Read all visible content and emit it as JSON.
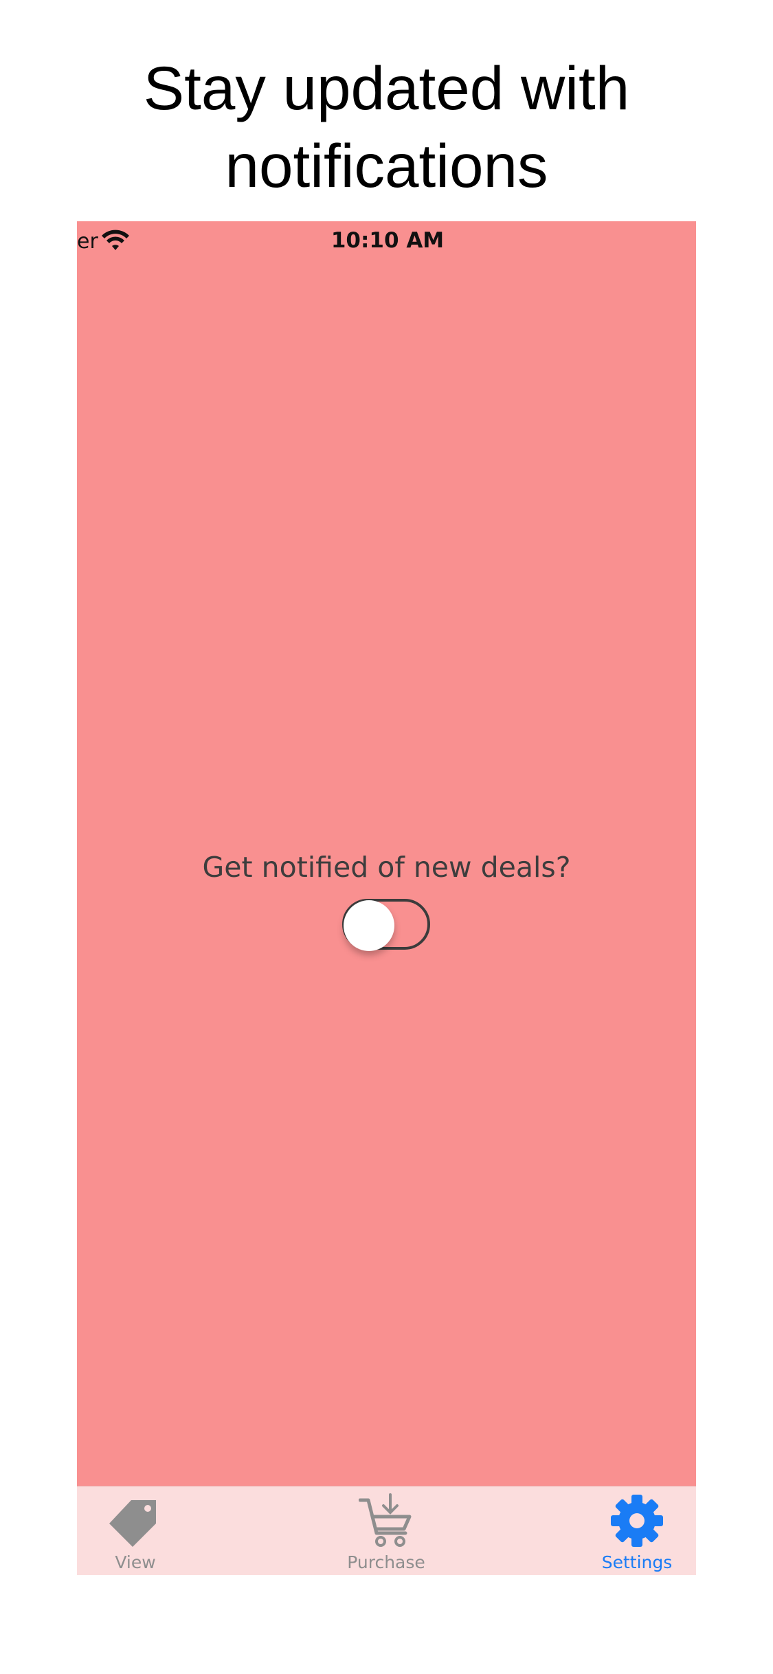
{
  "headline": {
    "line1": "Stay updated with",
    "line2": "notifications"
  },
  "status_bar": {
    "carrier": "er",
    "time": "10:10 AM",
    "wifi_icon": "wifi-icon"
  },
  "settings": {
    "prompt": "Get notified of new deals?",
    "notifications_enabled": false
  },
  "tab_bar": {
    "tabs": [
      {
        "label": "View",
        "icon": "tag-icon",
        "selected": false
      },
      {
        "label": "Purchase",
        "icon": "cart-icon",
        "selected": false
      },
      {
        "label": "Settings",
        "icon": "gear-icon",
        "selected": true
      }
    ]
  },
  "colors": {
    "background": "#f99090",
    "tab_bar": "#fbdddd",
    "tab_inactive": "#8e8e8e",
    "tab_active": "#1a7cf5",
    "text": "#3d3d3d"
  }
}
